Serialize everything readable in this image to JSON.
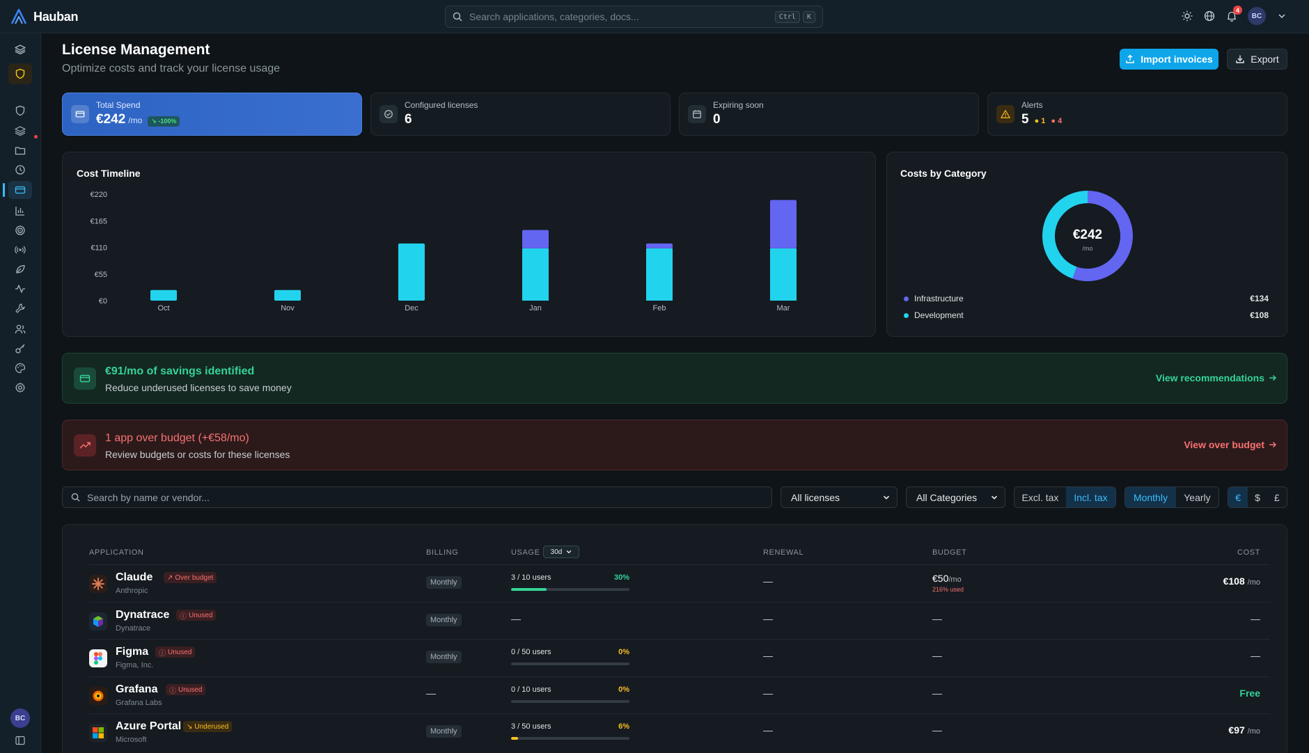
{
  "app": {
    "name": "Hauban"
  },
  "topbar": {
    "search_placeholder": "Search applications, categories, docs...",
    "kbd1": "Ctrl",
    "kbd2": "K",
    "notifications": "4",
    "user_initials": "BC"
  },
  "sidebar": {
    "user_initials": "BC",
    "icons": [
      "layers-icon",
      "shield-icon",
      "shield-outline-icon",
      "layers-outline-icon",
      "folder-icon",
      "clock-icon",
      "credit-card-icon",
      "bar-chart-icon",
      "target-icon",
      "radio-icon",
      "leaf-icon",
      "activity-icon",
      "wrench-icon",
      "users-icon",
      "key-icon",
      "palette-icon",
      "settings-icon"
    ]
  },
  "header": {
    "title": "License Management",
    "subtitle": "Optimize costs and track your license usage",
    "import_label": "Import invoices",
    "export_label": "Export"
  },
  "stats": {
    "total_spend": {
      "label": "Total Spend",
      "value": "€242",
      "unit": "/mo",
      "trend": "-100%"
    },
    "configured": {
      "label": "Configured licenses",
      "value": "6"
    },
    "expiring": {
      "label": "Expiring soon",
      "value": "0"
    },
    "alerts": {
      "label": "Alerts",
      "value": "5",
      "amber": "1",
      "red": "4"
    }
  },
  "colors": {
    "accent": "#0ea5e9",
    "infrastructure": "#6366f1",
    "development": "#22d3ee",
    "success": "#34d399",
    "danger": "#f87171",
    "warning": "#fbbf24"
  },
  "chart_data": [
    {
      "type": "bar",
      "title": "Cost Timeline",
      "stacked": true,
      "categories": [
        "Oct",
        "Nov",
        "Dec",
        "Jan",
        "Feb",
        "Mar"
      ],
      "series": [
        {
          "name": "Development",
          "values": [
            22,
            22,
            118,
            108,
            108,
            108
          ]
        },
        {
          "name": "Infrastructure",
          "values": [
            0,
            0,
            0,
            38,
            10,
            100
          ]
        }
      ],
      "yticks": [
        "€0",
        "€55",
        "€110",
        "€165",
        "€220"
      ],
      "ylim": [
        0,
        220
      ]
    },
    {
      "type": "pie",
      "title": "Costs by Category",
      "center_value": "€242",
      "center_unit": "/mo",
      "labels": [
        "Infrastructure",
        "Development"
      ],
      "values": [
        134,
        108
      ],
      "display_values": [
        "€134",
        "€108"
      ]
    }
  ],
  "savings": {
    "title": "€91/mo of savings identified",
    "subtitle": "Reduce underused licenses to save money",
    "link": "View recommendations"
  },
  "over_budget": {
    "title": "1 app over budget",
    "extra": "(+€58/mo)",
    "subtitle": "Review budgets or costs for these licenses",
    "link": "View over budget"
  },
  "filters": {
    "search_placeholder": "Search by name or vendor...",
    "license_select": "All licenses",
    "category_select": "All Categories",
    "tax": [
      "Excl. tax",
      "Incl. tax"
    ],
    "period": [
      "Monthly",
      "Yearly"
    ],
    "currency": [
      "€",
      "$",
      "£"
    ]
  },
  "table": {
    "headers": {
      "application": "APPLICATION",
      "billing": "BILLING",
      "usage": "USAGE",
      "renewal": "RENEWAL",
      "budget": "BUDGET",
      "cost": "COST"
    },
    "usage_range": "30d",
    "rows": [
      {
        "name": "Claude",
        "vendor": "Anthropic",
        "tag": "Over budget",
        "billing": "Monthly",
        "usage": "3 / 10 users",
        "pct": "30%",
        "fill": 0.3,
        "renewal": "—",
        "budget": "€50",
        "budget_unit": "/mo",
        "budget_used": "216% used",
        "cost": "€108",
        "cost_unit": "/mo"
      },
      {
        "name": "Dynatrace",
        "vendor": "Dynatrace",
        "tag": "Unused",
        "billing": "Monthly",
        "usage": "—",
        "renewal": "—",
        "budget": "—",
        "cost": "—"
      },
      {
        "name": "Figma",
        "vendor": "Figma, Inc.",
        "tag": "Unused",
        "billing": "Monthly",
        "usage": "0 / 50 users",
        "pct": "0%",
        "fill": 0.0,
        "renewal": "—",
        "budget": "—",
        "cost": "—"
      },
      {
        "name": "Grafana",
        "vendor": "Grafana Labs",
        "tag": "Unused",
        "billing": "—",
        "usage": "0 / 10 users",
        "pct": "0%",
        "fill": 0.0,
        "renewal": "—",
        "budget": "—",
        "cost": "Free"
      },
      {
        "name": "Azure Portal",
        "vendor": "Microsoft",
        "tag": "Underused",
        "billing": "Monthly",
        "usage": "3 / 50 users",
        "pct": "6%",
        "fill": 0.06,
        "renewal": "—",
        "budget": "—",
        "cost": "€97",
        "cost_unit": "/mo"
      }
    ]
  }
}
